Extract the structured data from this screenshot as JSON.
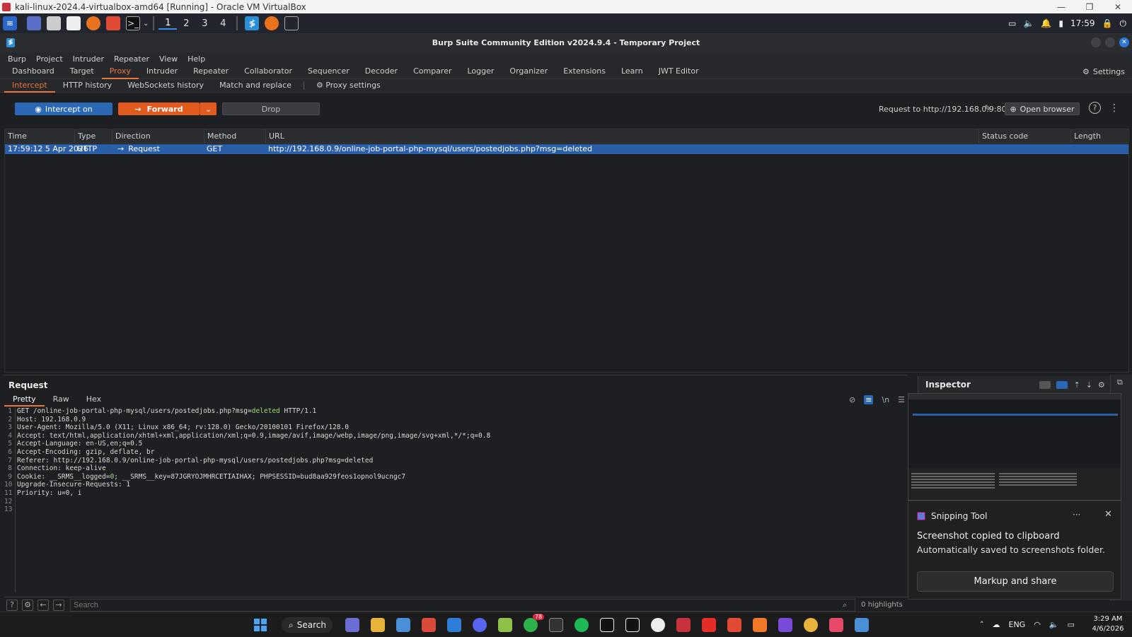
{
  "vbox": {
    "title": "kali-linux-2024.4-virtualbox-amd64 [Running] - Oracle VM VirtualBox",
    "controls": [
      "—",
      "❐",
      "✕"
    ]
  },
  "kali_panel": {
    "workspaces": [
      "1",
      "2",
      "3",
      "4"
    ],
    "time": "17:59"
  },
  "burp": {
    "title": "Burp Suite Community Edition v2024.9.4 - Temporary Project",
    "logo": "≸"
  },
  "menu": [
    "Burp",
    "Project",
    "Intruder",
    "Repeater",
    "View",
    "Help"
  ],
  "main_tabs": [
    "Dashboard",
    "Target",
    "Proxy",
    "Intruder",
    "Repeater",
    "Collaborator",
    "Sequencer",
    "Decoder",
    "Comparer",
    "Logger",
    "Organizer",
    "Extensions",
    "Learn",
    "JWT Editor"
  ],
  "settings_label": "Settings",
  "sub_tabs": [
    "Intercept",
    "HTTP history",
    "WebSockets history",
    "Match and replace"
  ],
  "proxy_settings_label": "Proxy settings",
  "actions": {
    "intercept": "Intercept on",
    "forward": "Forward",
    "drop": "Drop",
    "request_to": "Request to http://192.168.0.9:80",
    "open_browser": "Open browser",
    "help": "?"
  },
  "table": {
    "columns": [
      "Time",
      "Type",
      "Direction",
      "Method",
      "URL",
      "Status code",
      "Length"
    ],
    "rows": [
      {
        "time": "17:59:12 5 Apr 2026",
        "type": "HTTP",
        "direction": "Request",
        "method": "GET",
        "url": "http://192.168.0.9/online-job-portal-php-mysql/users/postedjobs.php?msg=deleted",
        "status": "",
        "length": ""
      }
    ]
  },
  "request_pane": {
    "title": "Request",
    "tabs": [
      "Pretty",
      "Raw",
      "Hex"
    ],
    "newline_label": "\\n",
    "lines": [
      {
        "n": "1",
        "pre": "GET /online-job-portal-php-mysql/users/postedjobs.php?msg=",
        "hl": "deleted",
        "post": " HTTP/1.1"
      },
      {
        "n": "2",
        "pre": "Host: 192.168.0.9",
        "hl": "",
        "post": ""
      },
      {
        "n": "3",
        "pre": "User-Agent: Mozilla/5.0 (X11; Linux x86_64; rv:128.0) Gecko/20100101 Firefox/128.0",
        "hl": "",
        "post": ""
      },
      {
        "n": "4",
        "pre": "Accept: text/html,application/xhtml+xml,application/xml;q=0.9,image/avif,image/webp,image/png,image/svg+xml,*/*;q=0.8",
        "hl": "",
        "post": ""
      },
      {
        "n": "5",
        "pre": "Accept-Language: en-US,en;q=0.5",
        "hl": "",
        "post": ""
      },
      {
        "n": "6",
        "pre": "Accept-Encoding: gzip, deflate, br",
        "hl": "",
        "post": ""
      },
      {
        "n": "7",
        "pre": "Referer: http://192.168.0.9/online-job-portal-php-mysql/users/postedjobs.php?msg=deleted",
        "hl": "",
        "post": ""
      },
      {
        "n": "8",
        "pre": "Connection: keep-alive",
        "hl": "",
        "post": ""
      },
      {
        "n": "9",
        "pre": "Cookie: __SRMS__logged=",
        "hl": "0",
        "post": "; __SRMS__key=87JGRYOJMHRCETIAIHAX; PHPSESSID=bud8aa929feos1opnol9ucngc7"
      },
      {
        "n": "10",
        "pre": "Upgrade-Insecure-Requests: 1",
        "hl": "",
        "post": ""
      },
      {
        "n": "11",
        "pre": "Priority: u=0, i",
        "hl": "",
        "post": ""
      },
      {
        "n": "12",
        "pre": "",
        "hl": "",
        "post": ""
      },
      {
        "n": "13",
        "pre": "",
        "hl": "",
        "post": ""
      }
    ],
    "search_placeholder": "Search",
    "highlights": "0 highlights"
  },
  "inspector": {
    "title": "Inspector"
  },
  "snipping": {
    "app": "Snipping Tool",
    "more": "···",
    "close": "✕",
    "message": "Screenshot copied to clipboard",
    "sub": "Automatically saved to screenshots folder.",
    "button": "Markup and share"
  },
  "taskbar": {
    "search": "Search",
    "badge": "78",
    "lang": "ENG",
    "time": "3:29 AM",
    "date": "4/6/2026"
  }
}
